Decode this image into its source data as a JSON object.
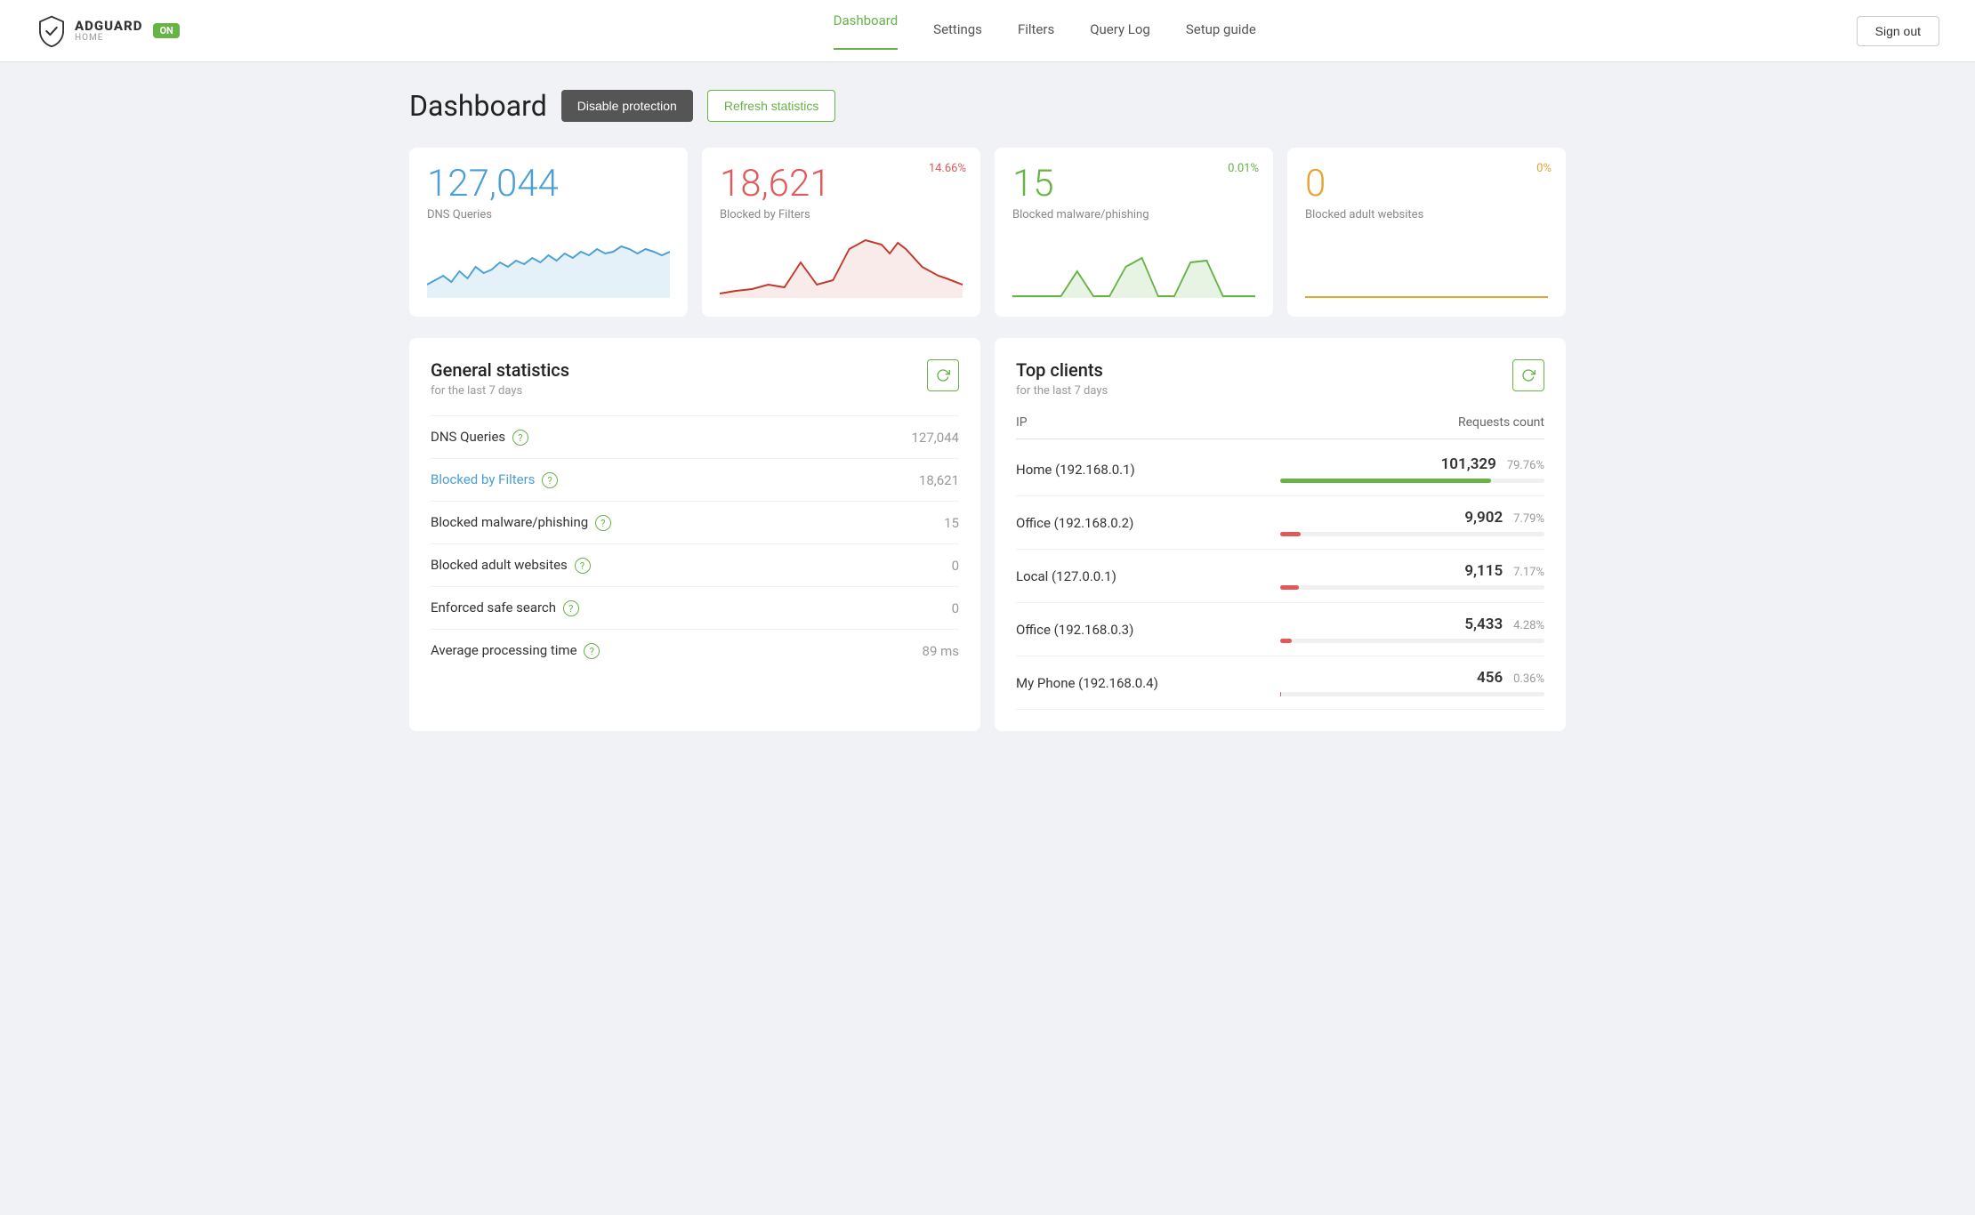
{
  "brand": {
    "name": "ADGUARD",
    "sub": "HOME",
    "badge": "ON"
  },
  "nav": {
    "links": [
      {
        "label": "Dashboard",
        "active": true
      },
      {
        "label": "Settings",
        "active": false
      },
      {
        "label": "Filters",
        "active": false
      },
      {
        "label": "Query Log",
        "active": false
      },
      {
        "label": "Setup guide",
        "active": false
      }
    ],
    "signout": "Sign out"
  },
  "page": {
    "title": "Dashboard",
    "disable_btn": "Disable protection",
    "refresh_btn": "Refresh statistics"
  },
  "stat_cards": [
    {
      "value": "127,044",
      "label": "DNS Queries",
      "percent": "",
      "value_color": "blue",
      "percent_color": "",
      "chart_color": "#4a9fd4",
      "chart_fill": "rgba(74,159,212,0.15)"
    },
    {
      "value": "18,621",
      "label": "Blocked by Filters",
      "percent": "14.66%",
      "value_color": "red",
      "percent_color": "red",
      "chart_color": "#c0392b",
      "chart_fill": "rgba(192,57,43,0.1)"
    },
    {
      "value": "15",
      "label": "Blocked malware/phishing",
      "percent": "0.01%",
      "value_color": "green",
      "percent_color": "green",
      "chart_color": "#67b346",
      "chart_fill": "rgba(103,179,70,0.15)"
    },
    {
      "value": "0",
      "label": "Blocked adult websites",
      "percent": "0%",
      "value_color": "yellow",
      "percent_color": "yellow",
      "chart_color": "#e8a430",
      "chart_fill": "rgba(232,164,48,0.1)"
    }
  ],
  "general_stats": {
    "title": "General statistics",
    "subtitle": "for the last 7 days",
    "rows": [
      {
        "label": "DNS Queries",
        "value": "127,044",
        "is_link": false,
        "help": true
      },
      {
        "label": "Blocked by Filters",
        "value": "18,621",
        "is_link": true,
        "help": true
      },
      {
        "label": "Blocked malware/phishing",
        "value": "15",
        "is_link": false,
        "help": true
      },
      {
        "label": "Blocked adult websites",
        "value": "0",
        "is_link": false,
        "help": true
      },
      {
        "label": "Enforced safe search",
        "value": "0",
        "is_link": false,
        "help": true
      },
      {
        "label": "Average processing time",
        "value": "89 ms",
        "is_link": false,
        "help": true
      }
    ]
  },
  "top_clients": {
    "title": "Top clients",
    "subtitle": "for the last 7 days",
    "col_ip": "IP",
    "col_requests": "Requests count",
    "rows": [
      {
        "name": "Home (192.168.0.1)",
        "count": "101,329",
        "pct": "79.76%",
        "bar_pct": 79.76,
        "bar_color": "pb-green"
      },
      {
        "name": "Office (192.168.0.2)",
        "count": "9,902",
        "pct": "7.79%",
        "bar_pct": 7.79,
        "bar_color": "pb-red"
      },
      {
        "name": "Local (127.0.0.1)",
        "count": "9,115",
        "pct": "7.17%",
        "bar_pct": 7.17,
        "bar_color": "pb-red"
      },
      {
        "name": "Office (192.168.0.3)",
        "count": "5,433",
        "pct": "4.28%",
        "bar_pct": 4.28,
        "bar_color": "pb-red"
      },
      {
        "name": "My Phone (192.168.0.4)",
        "count": "456",
        "pct": "0.36%",
        "bar_pct": 0.36,
        "bar_color": "pb-red"
      }
    ]
  }
}
